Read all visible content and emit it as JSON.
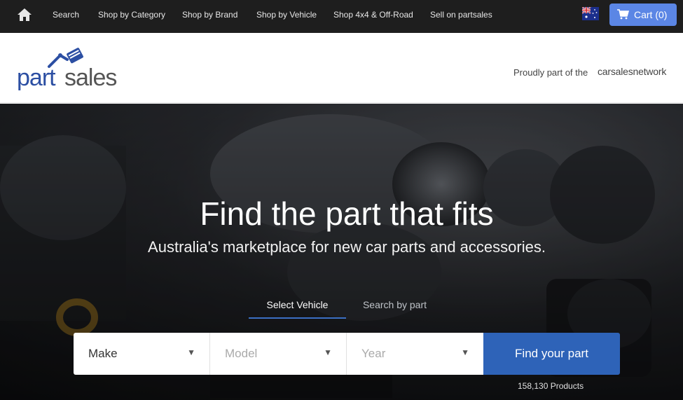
{
  "nav": {
    "home_icon": "home-icon",
    "links": [
      "Search",
      "Shop by Category",
      "Shop by Brand",
      "Shop by Vehicle",
      "Shop 4x4 & Off-Road",
      "Sell on partsales"
    ],
    "flag_icon": "australia-flag-icon",
    "cart_icon": "shopping-cart-icon",
    "cart_label": "Cart (0)"
  },
  "header": {
    "logo_part": "part",
    "logo_sales": "sales",
    "proudly": "Proudly part of the",
    "network": "carsalesnetwork"
  },
  "hero": {
    "title": "Find the part that fits",
    "subtitle": "Australia's marketplace for new car parts and accessories.",
    "tabs": [
      "Select Vehicle",
      "Search by part"
    ],
    "make": "Make",
    "model": "Model",
    "year": "Year",
    "arrow": "▼",
    "find_button": "Find your part",
    "products": "158,130 Products"
  },
  "colors": {
    "accent": "#2e63b8",
    "cart_button": "#5b86e5",
    "nav_bg": "#1e1e1e",
    "logo_blue": "#2c4fa3"
  }
}
